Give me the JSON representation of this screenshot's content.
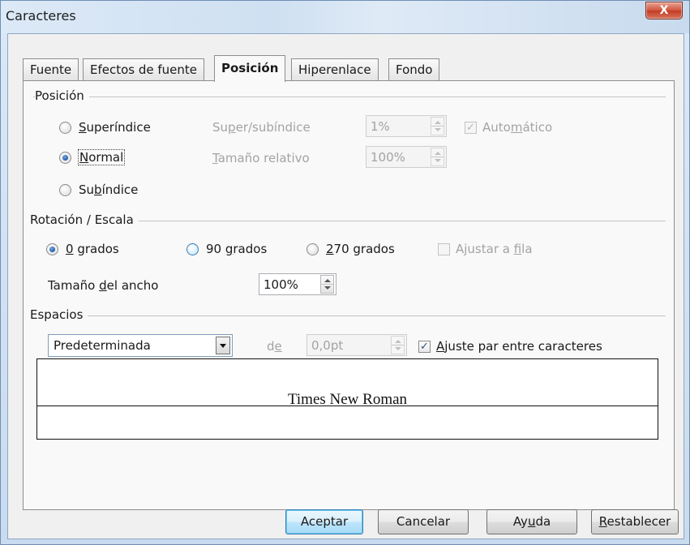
{
  "window": {
    "title": "Caracteres",
    "close_label": "X"
  },
  "tabs": [
    {
      "label": "Fuente",
      "active": false
    },
    {
      "label": "Efectos de fuente",
      "active": false
    },
    {
      "label": "Posición",
      "active": true
    },
    {
      "label": "Hiperenlace",
      "active": false
    },
    {
      "label": "Fondo",
      "active": false
    }
  ],
  "position_group": {
    "label": "Posición",
    "options": [
      {
        "pre": "",
        "u": "S",
        "post": "uperíndice",
        "checked": false
      },
      {
        "pre": "",
        "u": "N",
        "post": "ormal",
        "checked": true
      },
      {
        "pre": "Su",
        "u": "b",
        "post": "índice",
        "checked": false
      }
    ],
    "super_sub": {
      "pre": "Su",
      "u": "p",
      "post": "er/subíndice",
      "value": "1%"
    },
    "relative_size": {
      "pre": "",
      "u": "T",
      "post": "amaño relativo",
      "value": "100%"
    },
    "automatic": {
      "pre": "Auto",
      "u": "m",
      "post": "ático",
      "checked": true
    }
  },
  "rotation_group": {
    "label": "Rotación / Escala",
    "options": [
      {
        "pre": "",
        "u": "0",
        "post": " grados",
        "checked": true
      },
      {
        "pre": "90 ",
        "u": "g",
        "post": "rados",
        "checked": false
      },
      {
        "pre": "",
        "u": "2",
        "post": "70 grados",
        "checked": false
      }
    ],
    "fit_to_line": {
      "pre": "Ajustar a ",
      "u": "f",
      "post": "ila",
      "checked": false
    },
    "width_scale": {
      "pre": "Tamaño ",
      "u": "d",
      "post": "el ancho",
      "value": "100%"
    }
  },
  "spacing_group": {
    "label": "Espacios",
    "select_value": "Predeterminada",
    "of": {
      "pre": "d",
      "u": "e",
      "post": ""
    },
    "amount_value": "0,0pt",
    "pair_kerning": {
      "pre": "",
      "u": "A",
      "post": "juste par entre caracteres",
      "checked": true
    }
  },
  "preview": {
    "sample_text": "Times New Roman"
  },
  "buttons": {
    "ok": "Aceptar",
    "cancel": "Cancelar",
    "help": {
      "pre": "Ay",
      "u": "u",
      "post": "da"
    },
    "reset": {
      "pre": "",
      "u": "R",
      "post": "establecer"
    }
  },
  "colors": {
    "accent": "#3c7fb1",
    "disabled_text": "#a3a3a3",
    "title_bar": "#dce9f7"
  }
}
